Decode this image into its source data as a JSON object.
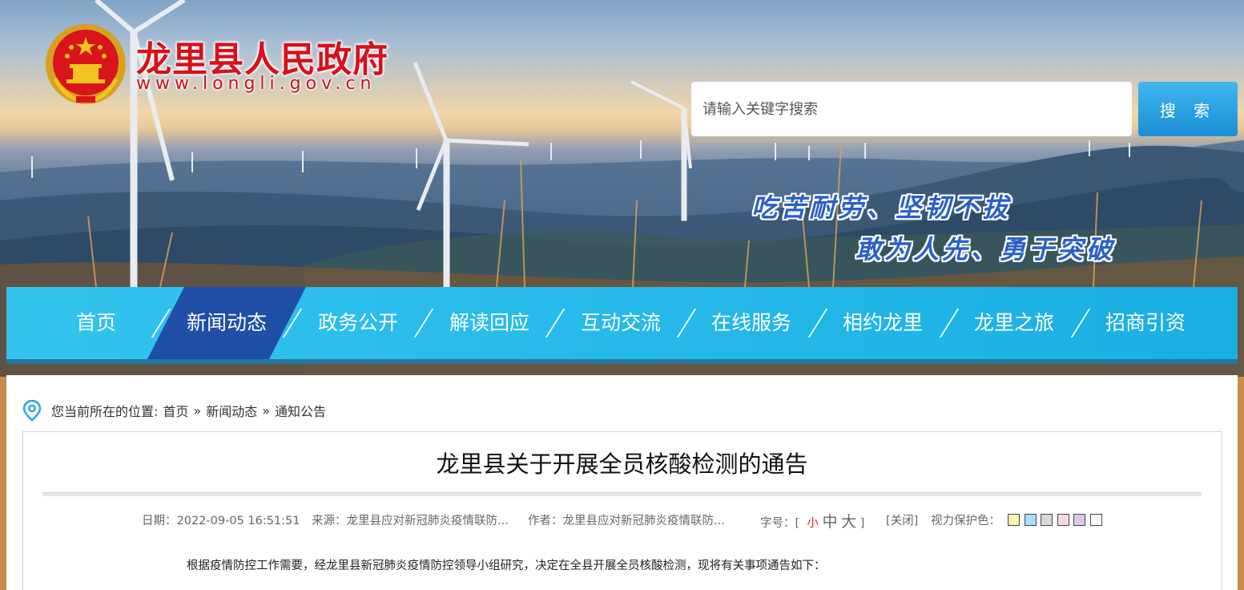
{
  "header": {
    "site_title": "龙里县人民政府",
    "site_url": "www.longli.gov.cn",
    "search": {
      "placeholder": "请输入关键字搜索",
      "button_label": "搜 索"
    },
    "slogans": [
      "吃苦耐劳、坚韧不拔",
      "敢为人先、勇于突破"
    ]
  },
  "nav": {
    "items": [
      "首页",
      "新闻动态",
      "政务公开",
      "解读回应",
      "互动交流",
      "在线服务",
      "相约龙里",
      "龙里之旅",
      "招商引资"
    ],
    "active": "新闻动态"
  },
  "breadcrumb": {
    "prefix": "您当前所在的位置:",
    "items": [
      "首页",
      "新闻动态",
      "通知公告"
    ],
    "separator": "»"
  },
  "article": {
    "title": "龙里县关于开展全员核酸检测的通告",
    "meta": {
      "date_label": "日期：",
      "date": "2022-09-05 16:51:51",
      "source_label": "来源：",
      "source": "龙里县应对新冠肺炎疫情联防...",
      "author_label": "作者：",
      "author": "龙里县应对新冠肺炎疫情联防...",
      "font_size_label": "字号：",
      "font_sizes": [
        "小",
        "中",
        "大"
      ],
      "close_label": "[关闭]",
      "eye_care_label": "视力保护色：",
      "eye_care_colors": [
        "#faf5b0",
        "#a9dff7",
        "#d8d8d8",
        "#f8d8df",
        "#ddc7f0",
        "#ffffff"
      ]
    },
    "first_paragraph": "根据疫情防控工作需要，经龙里县新冠肺炎疫情防控领导小组研究，决定在全县开展全员核酸检测，现将有关事项通告如下："
  },
  "colors": {
    "brand_red": "#d8101a",
    "nav_blue": "#1aaee3",
    "nav_active": "#1f4fa6",
    "slogan_blue": "#2b5fc9"
  },
  "icons": [
    "emblem-icon",
    "location-pin-icon"
  ]
}
